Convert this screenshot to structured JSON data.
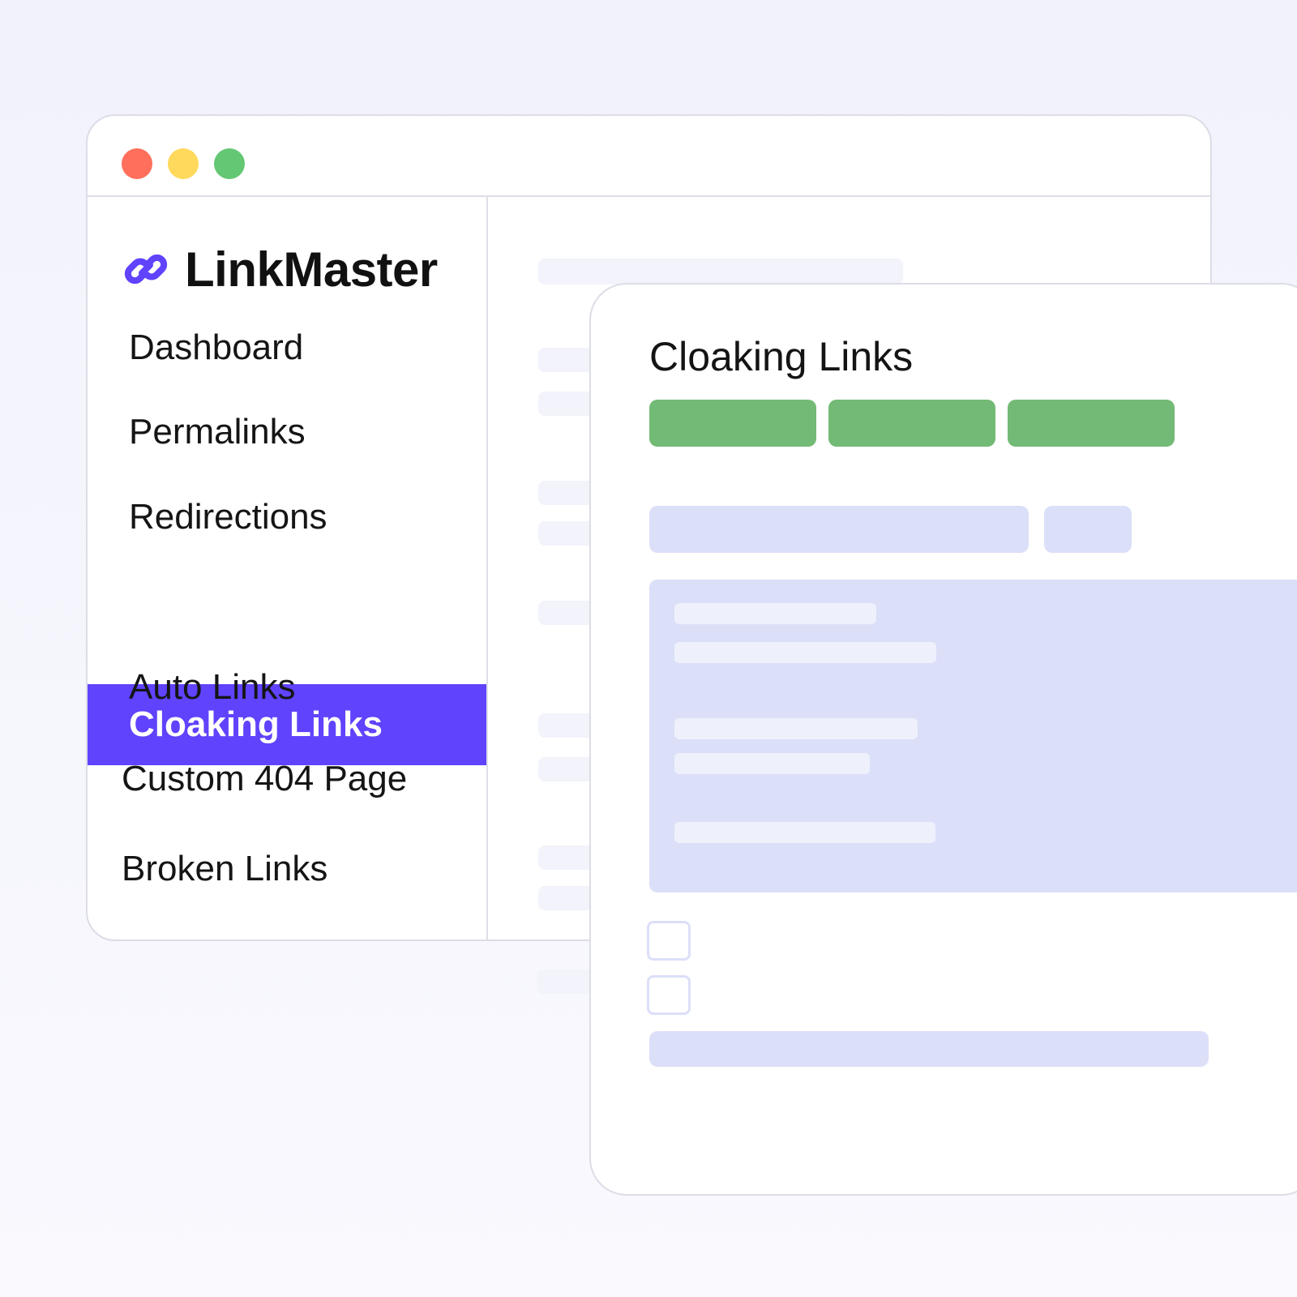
{
  "app": {
    "name": "LinkMaster",
    "logo_icon": "chain-link-icon"
  },
  "window_controls": [
    "close",
    "minimize",
    "maximize"
  ],
  "sidebar": {
    "items": [
      {
        "label": "Dashboard",
        "active": false
      },
      {
        "label": "Permalinks",
        "active": false
      },
      {
        "label": "Redirections",
        "active": false
      },
      {
        "label": "Cloaking Links",
        "active": true
      },
      {
        "label": "Auto Links",
        "active": false
      },
      {
        "label": "Custom 404 Page",
        "active": false
      },
      {
        "label": "Broken Links",
        "active": false
      }
    ]
  },
  "panel": {
    "title": "Cloaking Links"
  },
  "colors": {
    "accent": "#5f43fd",
    "button_green": "#72ba75",
    "placeholder": "#dcdff8",
    "dot_red": "#ff6f5c",
    "dot_yellow": "#ffd95c",
    "dot_green": "#63c774"
  }
}
